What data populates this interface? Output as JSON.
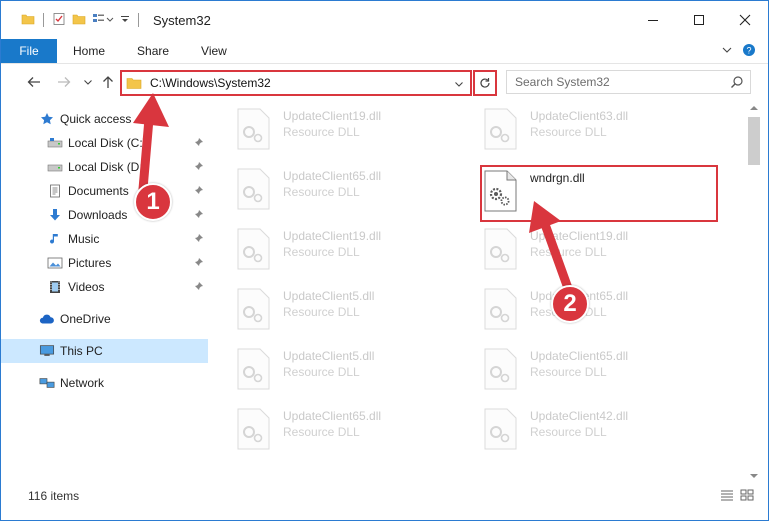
{
  "window": {
    "title": "System32"
  },
  "ribbon": {
    "tabs": [
      "File",
      "Home",
      "Share",
      "View"
    ]
  },
  "address": {
    "path": "C:\\Windows\\System32"
  },
  "search": {
    "placeholder": "Search System32"
  },
  "sidebar": {
    "items": [
      {
        "label": "Quick access",
        "icon": "star-icon",
        "pinned": false
      },
      {
        "label": "Local Disk (C:)",
        "icon": "drive-icon",
        "pinned": true
      },
      {
        "label": "Local Disk (D:)",
        "icon": "drive-icon",
        "pinned": true
      },
      {
        "label": "Documents",
        "icon": "document-icon",
        "pinned": true
      },
      {
        "label": "Downloads",
        "icon": "download-icon",
        "pinned": true
      },
      {
        "label": "Music",
        "icon": "music-icon",
        "pinned": true
      },
      {
        "label": "Pictures",
        "icon": "pictures-icon",
        "pinned": true
      },
      {
        "label": "Videos",
        "icon": "video-icon",
        "pinned": true
      },
      {
        "label": "OneDrive",
        "icon": "cloud-icon",
        "pinned": false
      },
      {
        "label": "This PC",
        "icon": "computer-icon",
        "pinned": false,
        "selected": true
      },
      {
        "label": "Network",
        "icon": "network-icon",
        "pinned": false
      }
    ]
  },
  "files": {
    "left": [
      {
        "name": "UpdateClient19.dll",
        "type": "Resource DLL"
      },
      {
        "name": "UpdateClient65.dll",
        "type": "Resource DLL"
      },
      {
        "name": "UpdateClient19.dll",
        "type": "Resource DLL"
      },
      {
        "name": "UpdateClient5.dll",
        "type": "Resource DLL"
      },
      {
        "name": "UpdateClient5.dll",
        "type": "Resource DLL"
      },
      {
        "name": "UpdateClient65.dll",
        "type": "Resource DLL"
      }
    ],
    "right": [
      {
        "name": "UpdateClient63.dll",
        "type": "Resource DLL"
      },
      {
        "name": "wndrgn.dll",
        "type": ""
      },
      {
        "name": "UpdateClient19.dll",
        "type": "Resource DLL"
      },
      {
        "name": "UpdateClient65.dll",
        "type": "Resource DLL"
      },
      {
        "name": "UpdateClient65.dll",
        "type": "Resource DLL"
      },
      {
        "name": "UpdateClient42.dll",
        "type": "Resource DLL"
      }
    ]
  },
  "status": {
    "item_count": "116 items"
  },
  "annotations": {
    "step1": "1",
    "step2": "2"
  },
  "colors": {
    "accent": "#1979ca",
    "annotation": "#d9363e",
    "selected": "#cce8ff"
  }
}
